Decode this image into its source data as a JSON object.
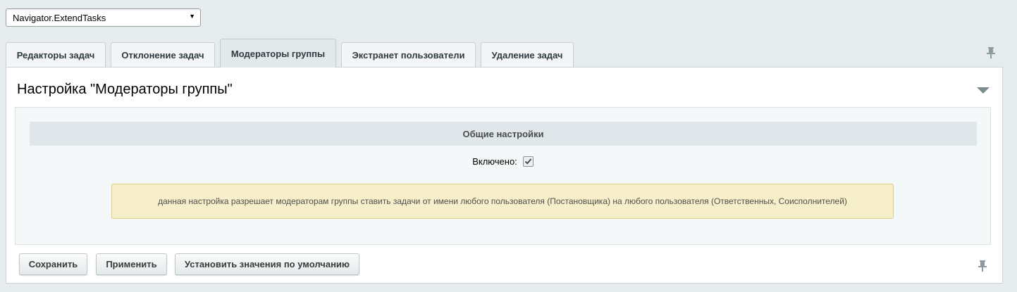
{
  "module_select": {
    "value": "Navigator.ExtendTasks"
  },
  "tabs": [
    {
      "label": "Редакторы задач",
      "active": false
    },
    {
      "label": "Отклонение задач",
      "active": false
    },
    {
      "label": "Модераторы группы",
      "active": true
    },
    {
      "label": "Экстранет пользователи",
      "active": false
    },
    {
      "label": "Удаление задач",
      "active": false
    }
  ],
  "panel": {
    "title": "Настройка \"Модераторы группы\"",
    "section_title": "Общие настройки",
    "enabled_label": "Включено:",
    "enabled_checked": true,
    "note": "данная настройка разрешает модераторам группы ставить задачи от имени любого пользователя (Постановщика) на любого пользователя (Ответственных, Соисполнителей)"
  },
  "buttons": {
    "save": "Сохранить",
    "apply": "Применить",
    "defaults": "Установить значения по умолчанию"
  },
  "icons": {
    "pin": "pin-icon",
    "collapse": "chevron-down-icon",
    "dropdown": "dropdown-arrow-icon",
    "check": "checkmark-icon"
  },
  "colors": {
    "background": "#e6ebed",
    "tab_active": "#e3e8ea",
    "note_background": "#f6efc9",
    "section_header": "#e0e7ea"
  }
}
